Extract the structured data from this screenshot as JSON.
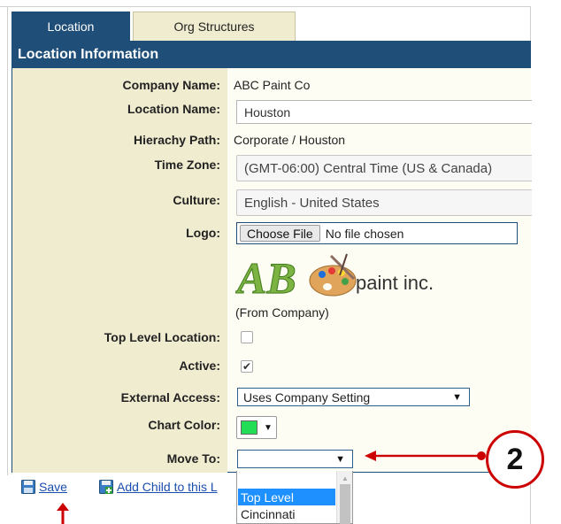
{
  "tabs": [
    {
      "label": "Location",
      "active": true
    },
    {
      "label": "Org Structures",
      "active": false
    }
  ],
  "panel": {
    "header": "Location Information",
    "company_name": {
      "label": "Company Name:",
      "value": "ABC Paint Co"
    },
    "location_name": {
      "label": "Location Name:",
      "value": "Houston"
    },
    "hierarchy_path": {
      "label": "Hierachy Path:",
      "value": "Corporate / Houston"
    },
    "time_zone": {
      "label": "Time Zone:",
      "value": "(GMT-06:00) Central Time (US & Canada)"
    },
    "culture": {
      "label": "Culture:",
      "value": "English - United States"
    },
    "logo": {
      "label": "Logo:",
      "button": "Choose File",
      "status": "No file chosen",
      "logo_text": "paint inc.",
      "source": "(From Company)"
    },
    "top_level_location": {
      "label": "Top Level Location:",
      "checked": false
    },
    "active": {
      "label": "Active:",
      "checked": true,
      "check_glyph": "✔"
    },
    "external_access": {
      "label": "External Access:",
      "value": "Uses Company Setting"
    },
    "chart_color": {
      "label": "Chart Color:",
      "color": "#22dd55"
    },
    "move_to": {
      "label": "Move To:",
      "value": ""
    }
  },
  "move_to_options": [
    {
      "label": "Top Level",
      "selected": true
    },
    {
      "label": "Cincinnati",
      "selected": false
    }
  ],
  "footer": {
    "save_label": "Save",
    "add_child_label": "Add Child to this L"
  },
  "annotation": {
    "callout_number": "2",
    "color": "#cc0000"
  },
  "glyphs": {
    "dropdown_arrow": "▼",
    "scroll_up": "▲"
  }
}
